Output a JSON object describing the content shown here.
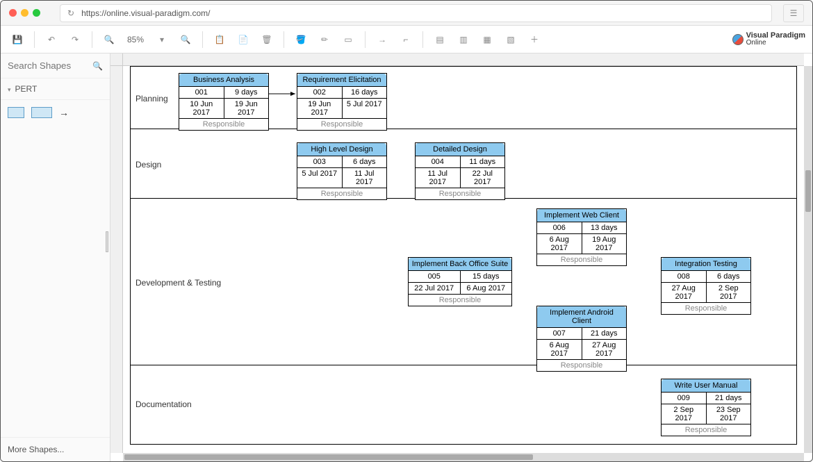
{
  "url": "https://online.visual-paradigm.com/",
  "zoom": "85%",
  "brand": {
    "line1": "Visual Paradigm",
    "line2": "Online"
  },
  "sidebar": {
    "search_placeholder": "Search Shapes",
    "category": "PERT",
    "more": "More Shapes..."
  },
  "lanes": [
    {
      "label": "Planning"
    },
    {
      "label": "Design"
    },
    {
      "label": "Development & Testing"
    },
    {
      "label": "Documentation"
    }
  ],
  "tasks": {
    "t1": {
      "name": "Business Analysis",
      "id": "001",
      "dur": "9 days",
      "start": "10 Jun 2017",
      "end": "19 Jun 2017",
      "resp": "Responsible"
    },
    "t2": {
      "name": "Requirement Elicitation",
      "id": "002",
      "dur": "16 days",
      "start": "19 Jun 2017",
      "end": "5 Jul 2017",
      "resp": "Responsible"
    },
    "t3": {
      "name": "High Level Design",
      "id": "003",
      "dur": "6 days",
      "start": "5 Jul 2017",
      "end": "11 Jul 2017",
      "resp": "Responsible"
    },
    "t4": {
      "name": "Detailed Design",
      "id": "004",
      "dur": "11 days",
      "start": "11 Jul 2017",
      "end": "22 Jul 2017",
      "resp": "Responsible"
    },
    "t5": {
      "name": "Implement Back Office Suite",
      "id": "005",
      "dur": "15 days",
      "start": "22 Jul 2017",
      "end": "6 Aug 2017",
      "resp": "Responsible"
    },
    "t6": {
      "name": "Implement Web Client",
      "id": "006",
      "dur": "13 days",
      "start": "6 Aug 2017",
      "end": "19 Aug 2017",
      "resp": "Responsible"
    },
    "t7": {
      "name": "Implement Android Client",
      "id": "007",
      "dur": "21 days",
      "start": "6 Aug 2017",
      "end": "27 Aug 2017",
      "resp": "Responsible"
    },
    "t8": {
      "name": "Integration Testing",
      "id": "008",
      "dur": "6 days",
      "start": "27 Aug 2017",
      "end": "2 Sep 2017",
      "resp": "Responsible"
    },
    "t9": {
      "name": "Write User Manual",
      "id": "009",
      "dur": "21 days",
      "start": "2 Sep 2017",
      "end": "23 Sep 2017",
      "resp": "Responsible"
    }
  }
}
